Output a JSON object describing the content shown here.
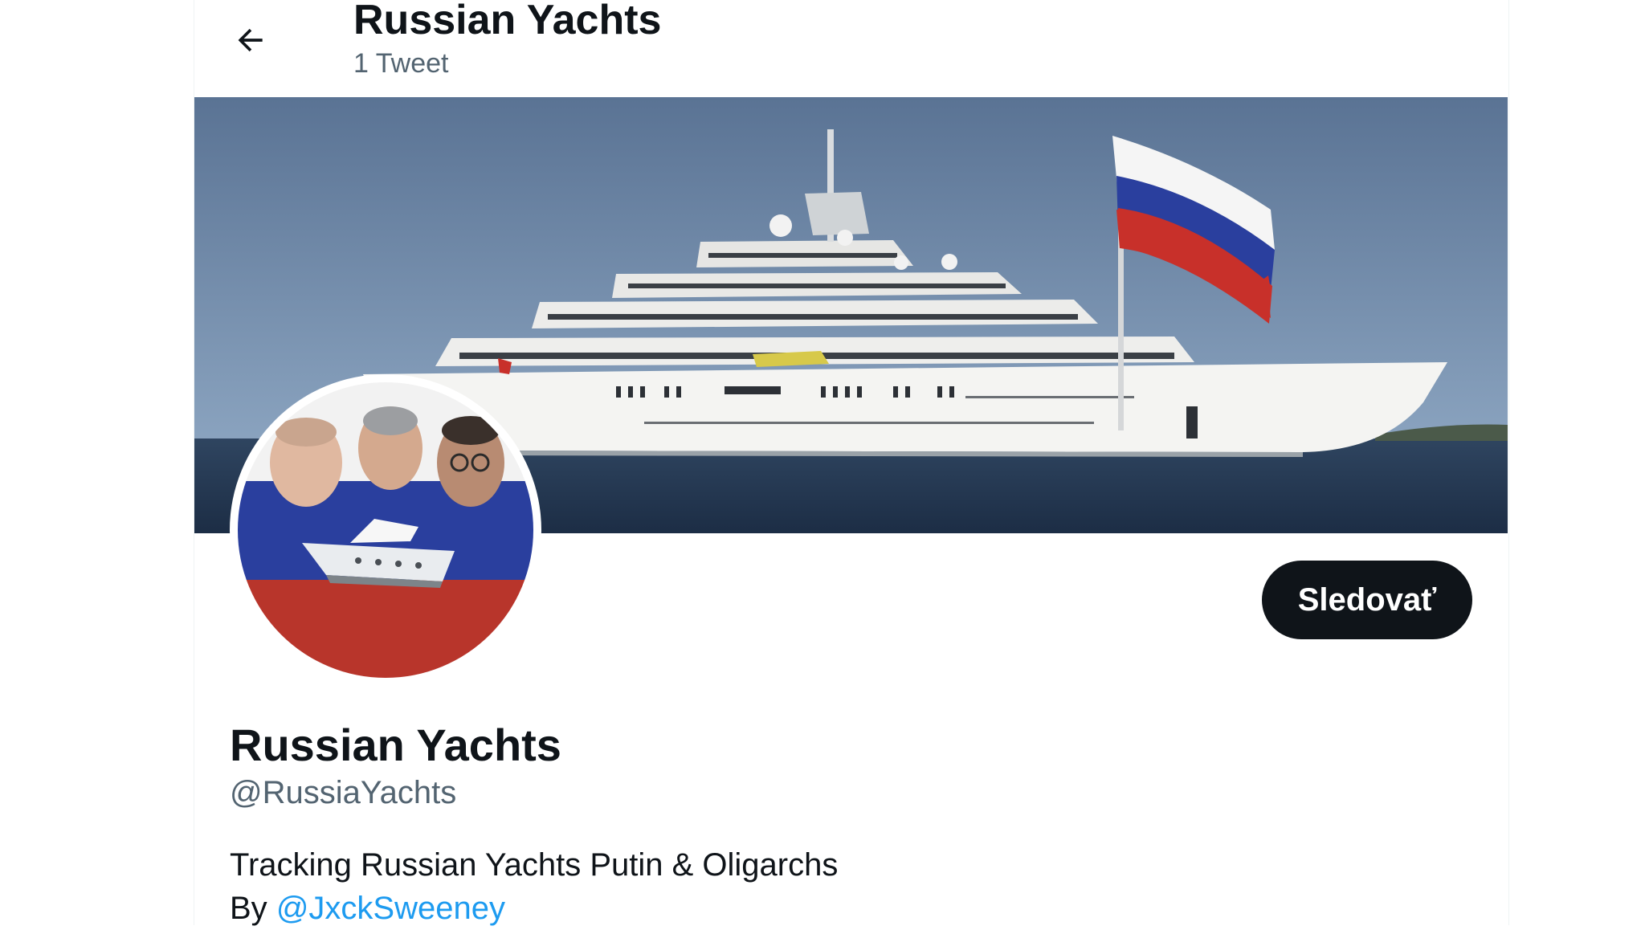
{
  "header": {
    "title": "Russian Yachts",
    "tweet_count": "1 Tweet"
  },
  "profile": {
    "display_name": "Russian Yachts",
    "handle": "@RussiaYachts",
    "bio": "Tracking Russian Yachts Putin & Oligarchs",
    "bio_by": "By",
    "bio_link": "@JxckSweeney",
    "follow_label": "Sledovať"
  },
  "colors": {
    "accent": "#1d9bf0",
    "follow_bg": "#0f1419",
    "flag_white": "#ffffff",
    "flag_blue": "#2a3f9e",
    "flag_red": "#b8352b"
  },
  "icons": {
    "back": "arrow-left-icon"
  }
}
